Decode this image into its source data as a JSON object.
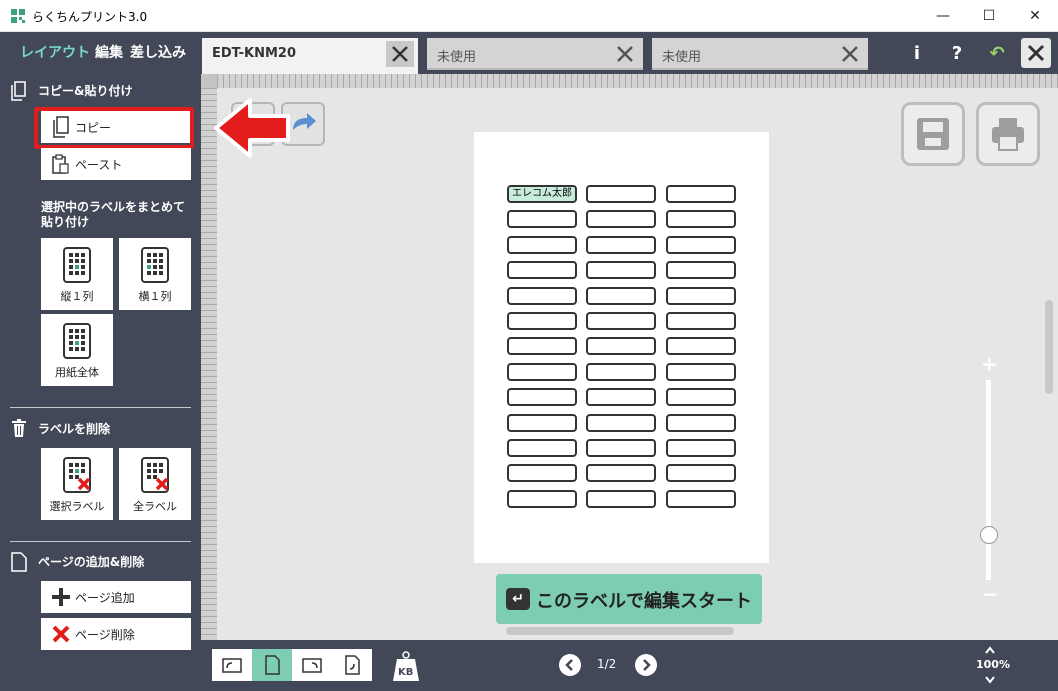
{
  "window": {
    "title": "らくちんプリント3.0",
    "minimize_symbol": "—",
    "maximize_symbol": "☐",
    "close_symbol": "✕"
  },
  "topbar": {
    "modes": [
      "レイアウト",
      "編集",
      "差し込み"
    ],
    "active_mode": "レイアウト",
    "tabs": [
      {
        "label": "EDT-KNM20",
        "active": true
      },
      {
        "label": "未使用",
        "active": false
      },
      {
        "label": "未使用",
        "active": false
      }
    ],
    "info_label": "i",
    "help_label": "?",
    "undo_symbol": "↶",
    "accent_color": "#7ad8c6"
  },
  "sidebar": {
    "copy_paste_title": "コピー&貼り付け",
    "copy_label": "コピー",
    "paste_label": "ペースト",
    "bulk_paste_title": "選択中のラベルをまとめて貼り付け",
    "bulk_buttons": [
      "縦１列",
      "横１列",
      "用紙全体"
    ],
    "delete_title": "ラベルを削除",
    "delete_buttons": [
      "選択ラベル",
      "全ラベル"
    ],
    "page_title": "ページの追加&削除",
    "add_page_label": "ページ追加",
    "delete_page_label": "ページ削除"
  },
  "canvas": {
    "sheet": {
      "rows": 13,
      "columns": 3,
      "first_label_text": "エレコム太郎"
    },
    "start_button_label": "このラベルで編集スタート",
    "zoom_plus": "+",
    "zoom_minus": "−"
  },
  "bottombar": {
    "page_indicator": "1/2",
    "zoom_percent": "100%",
    "weight_label": "KB"
  }
}
